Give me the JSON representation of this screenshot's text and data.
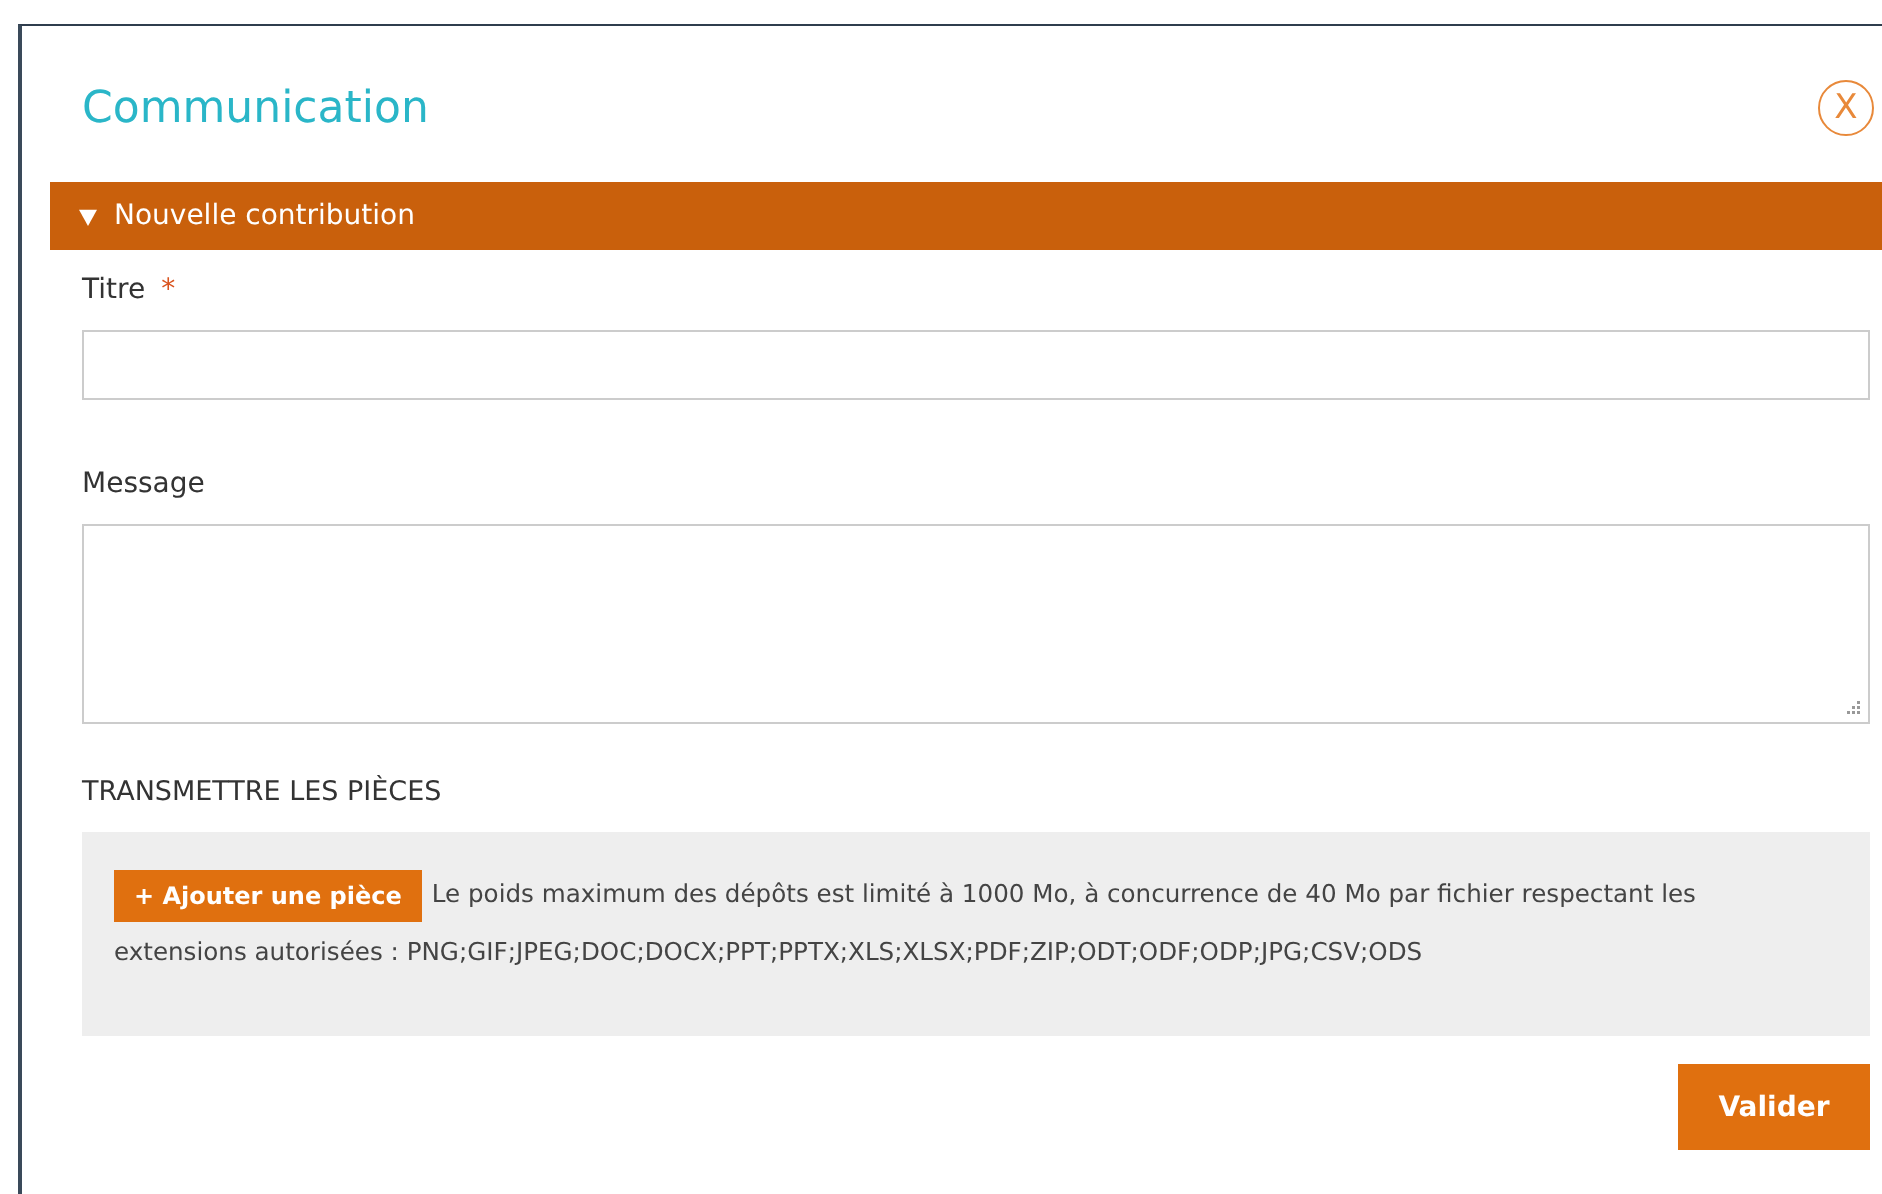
{
  "dialog": {
    "title": "Communication",
    "close_label": "X"
  },
  "section": {
    "label": "Nouvelle contribution",
    "expanded": true
  },
  "fields": [
    {
      "kind": "input",
      "label": "Titre",
      "required_mark": "*"
    },
    {
      "kind": "textarea",
      "label": "Message"
    }
  ],
  "attachments": {
    "heading": "TRANSMETTRE LES PIÈCES",
    "button": "+ Ajouter une pièce",
    "note_lines": [
      "Le poids maximum des dépôts est limité à 1000 Mo, à concurrence de 40 Mo par fichier respectant les",
      "extensions autorisées : PNG;GIF;JPEG;DOC;DOCX;PPT;PPTX;XLS;XLSX;PDF;ZIP;ODT;ODF;ODP;JPG;CSV;ODS"
    ]
  },
  "submit": "Valider"
}
